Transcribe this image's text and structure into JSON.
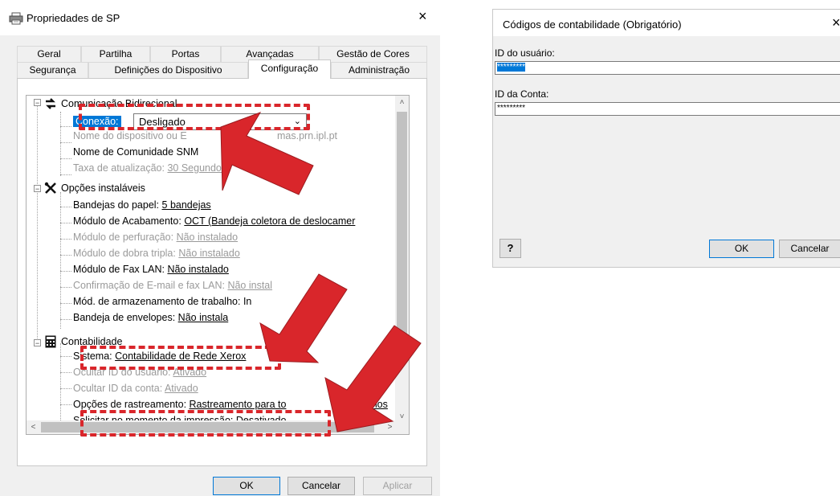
{
  "dialog1": {
    "title": "Propriedades de SP",
    "close_glyph": "×",
    "tabs_row1": [
      "Geral",
      "Partilha",
      "Portas",
      "Avançadas",
      "Gestão de Cores"
    ],
    "tabs_row2": [
      "Segurança",
      "Definições do Dispositivo",
      "Configuração",
      "Administração"
    ],
    "active_tab": "Configuração",
    "tree": {
      "bidirectional": {
        "label": "Comunicação Bidirecional",
        "connection_label": "Conexão:",
        "connection_value": "Desligado",
        "device_name_prefix": "Nome do dispositivo ou E",
        "device_name_suffix": "mas.prn.ipl.pt",
        "community_name": "Nome de Comunidade SNM",
        "refresh_label": "Taxa de atualização:",
        "refresh_value": "30 Segundos"
      },
      "installable": {
        "label": "Opções instaláveis",
        "trays_label": "Bandejas do papel:",
        "trays_value": "5 bandejas",
        "finisher_label": "Módulo de Acabamento:",
        "finisher_value": "OCT (Bandeja coletora de deslocamer",
        "punch_label": "Módulo de perfuração:",
        "punch_value": "Não instalado",
        "trifold_label": "Módulo de dobra tripla:",
        "trifold_value": "Não instalado",
        "fax_label": "Módulo de Fax LAN:",
        "fax_value": "Não instalado",
        "email_label": "Confirmação de E-mail e fax LAN:",
        "email_value": "Não instal",
        "storage_label": "Mód. de armazenamento de trabal",
        "storage_value": "ho: In",
        "envelope_label": "Bandeja de envelopes:",
        "envelope_value": "Não instala"
      },
      "accounting": {
        "label": "Contabilidade",
        "system_label": "Sistema:",
        "system_value": "Contabilidade de Rede Xerox",
        "hide_user_label": "Ocultar ID do usuário:",
        "hide_user_value": "Ativado",
        "hide_account_label": "Ocultar ID da conta:",
        "hide_account_value": "Ativado",
        "tracking_label": "Opções de rastreamento:",
        "tracking_value": "Rastreamento para to",
        "tracking_tail": "alhos",
        "prompt_label": "Solicitar no momento da impressão:",
        "prompt_value": "Desativado"
      }
    },
    "buttons": {
      "ok": "OK",
      "cancel": "Cancelar",
      "apply": "Aplicar"
    },
    "scroll_glyphs": {
      "up": "˄",
      "down": "˅",
      "left": "<",
      "right": ">"
    }
  },
  "dialog2": {
    "title": "Códigos de contabilidade (Obrigatório)",
    "close_glyph": "×",
    "user_id_label": "ID do usuário:",
    "user_id_value": "*********",
    "account_id_label": "ID da Conta:",
    "account_id_value": "*********",
    "help_glyph": "?",
    "buttons": {
      "ok": "OK",
      "cancel": "Cancelar"
    }
  },
  "colors": {
    "accent": "#0078d7",
    "annotation": "#d9262b"
  },
  "icons": {
    "printer": "printer-icon",
    "arrows": "bidirectional-arrows-icon",
    "tools": "tools-icon",
    "calculator": "calculator-icon"
  }
}
